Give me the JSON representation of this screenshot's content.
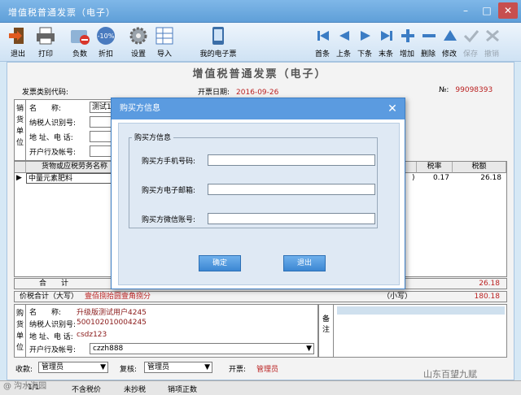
{
  "window": {
    "title": "增值税普通发票（电子）"
  },
  "toolbar": {
    "left": [
      {
        "label": "退出",
        "icon": "exit-door-icon"
      },
      {
        "label": "打印",
        "icon": "printer-icon"
      },
      {
        "label": "负数",
        "icon": "negative-folder-icon"
      },
      {
        "label": "折扣",
        "icon": "discount-badge-icon",
        "badge": "-10%"
      },
      {
        "label": "设置",
        "icon": "gear-icon"
      },
      {
        "label": "导入",
        "icon": "import-grid-icon"
      },
      {
        "label": "我的电子票",
        "icon": "e-invoice-icon"
      }
    ],
    "right": [
      {
        "label": "首条",
        "icon": "first-record-icon"
      },
      {
        "label": "上条",
        "icon": "prev-record-icon"
      },
      {
        "label": "下条",
        "icon": "next-record-icon"
      },
      {
        "label": "末条",
        "icon": "last-record-icon"
      },
      {
        "label": "增加",
        "icon": "add-icon"
      },
      {
        "label": "删除",
        "icon": "remove-icon"
      },
      {
        "label": "修改",
        "icon": "edit-icon"
      },
      {
        "label": "保存",
        "icon": "save-check-icon"
      },
      {
        "label": "撤销",
        "icon": "undo-icon"
      }
    ]
  },
  "form": {
    "title": "增值税普通发票（电子）",
    "type_code_label": "发票类别代码:",
    "issue_date_label": "开票日期:",
    "issue_date": "2016-09-26",
    "no_label": "№:",
    "no_value": "99098393",
    "seller": {
      "side_label": "销货单位",
      "name_label": "名　　称:",
      "name_value": "测试175",
      "taxid_label": "纳税人识别号:",
      "addr_label": "地 址、电 话:",
      "bank_label": "开户行及帐号:"
    },
    "grid": {
      "headers": [
        "货物或应税劳务名称",
        "税率",
        "税额"
      ],
      "row": {
        "name": "中量元素肥料",
        "rate_tail": ")",
        "rate": "0.17",
        "tax": "26.18"
      }
    },
    "total_label": "合　　计",
    "total_tax": "26.18",
    "grand_label": "价税合计（大写）",
    "grand_upper": "壹佰捌拾圆壹角捌分",
    "small_label": "（小写）",
    "small_value": "180.18",
    "buyer": {
      "side_label": "购货单位",
      "name_label": "名　　称:",
      "name_value": "升级版测试用户4245",
      "taxid_label": "纳税人识别号:",
      "taxid_value": "500102010004245",
      "addr_label": "地 址、电 话:",
      "addr_value": "csdz123",
      "bank_label": "开户行及帐号:",
      "bank_value": "czzh888"
    },
    "note_label": "备注",
    "payee_label": "收款:",
    "payee": "管理员",
    "reviewer_label": "复核:",
    "reviewer": "管理员",
    "drawer_label": "开票:",
    "drawer": "管理员"
  },
  "status": {
    "page": "1/1",
    "items": [
      "不含税价",
      "未抄税",
      "销项正数"
    ]
  },
  "dialog": {
    "title": "购买方信息",
    "group_label": "购买方信息",
    "phone_label": "购买方手机号码:",
    "email_label": "购买方电子邮箱:",
    "wechat_label": "购买方微信账号:",
    "confirm_label": "确定",
    "exit_label": "退出"
  },
  "watermark": {
    "left": "@ 沟水海园",
    "right": "山东百望九赋"
  }
}
